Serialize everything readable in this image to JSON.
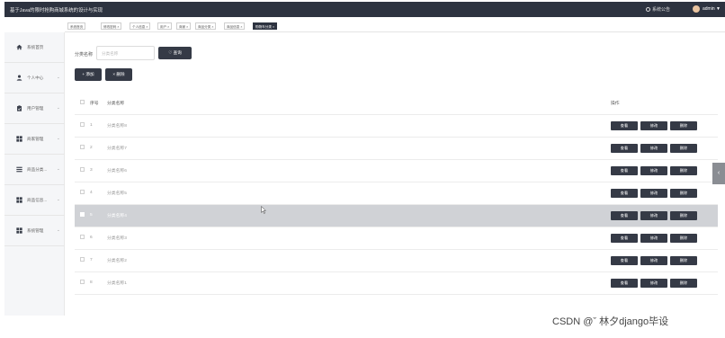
{
  "header": {
    "title": "基于Java的限时抢购商城系统的设计与实现",
    "notice": "系统公告",
    "user": "admin ▼"
  },
  "tabs": [
    "系统首页",
    "修改密码 ×",
    "个人信息 ×",
    "用户 ×",
    "商家 ×",
    "商品分类 ×",
    "商品信息 ×",
    "购物车分类 ×"
  ],
  "sidebar": {
    "items": [
      {
        "label": "系统首页",
        "icon": "home-icon",
        "caret": ""
      },
      {
        "label": "个人中心",
        "icon": "person-icon",
        "caret": "⌄"
      },
      {
        "label": "用户管理",
        "icon": "clipboard-icon",
        "caret": "⌄"
      },
      {
        "label": "商家管理",
        "icon": "grid-icon",
        "caret": "⌄"
      },
      {
        "label": "商品分类...",
        "icon": "list-icon",
        "caret": "⌄"
      },
      {
        "label": "商品信息...",
        "icon": "grid-icon",
        "caret": "⌄"
      },
      {
        "label": "系统管理",
        "icon": "grid-icon",
        "caret": "⌄"
      }
    ]
  },
  "search": {
    "label": "分类名称",
    "placeholder": "分类名称",
    "button": "♡ 查询"
  },
  "actions": {
    "add": "+ 添加",
    "delete": "× 删除"
  },
  "table": {
    "headers": {
      "index": "序号",
      "name": "分类名称",
      "ops": "操作"
    },
    "op_labels": {
      "view": "查看",
      "edit": "修改",
      "del": "删除"
    },
    "rows": [
      {
        "no": "1",
        "name": "分类名称8"
      },
      {
        "no": "2",
        "name": "分类名称7"
      },
      {
        "no": "3",
        "name": "分类名称6"
      },
      {
        "no": "4",
        "name": "分类名称5"
      },
      {
        "no": "5",
        "name": "分类名称4"
      },
      {
        "no": "6",
        "name": "分类名称3"
      },
      {
        "no": "7",
        "name": "分类名称2"
      },
      {
        "no": "8",
        "name": "分类名称1"
      }
    ],
    "highlighted_row": 5
  },
  "side_arrow": "‹",
  "watermark": "CSDN @ˇ 林夕django毕设",
  "colors": {
    "dark": "#2d3340",
    "button": "#353a46",
    "highlight": "#d0d2d6"
  }
}
